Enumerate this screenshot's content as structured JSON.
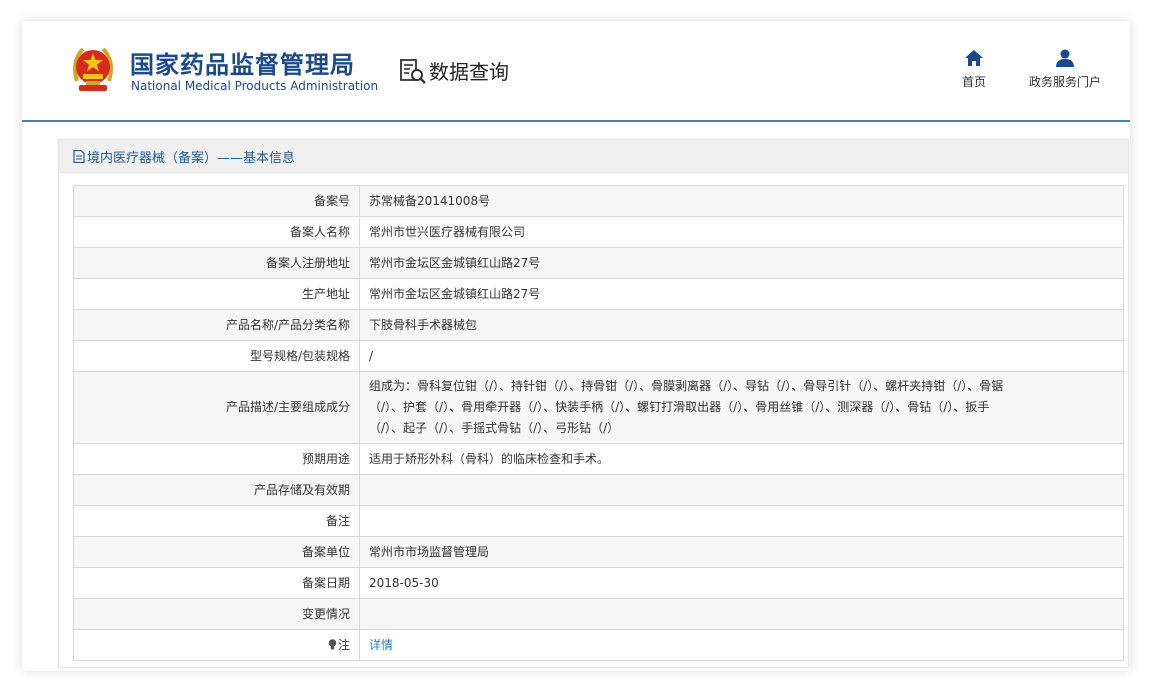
{
  "header": {
    "title_cn": "国家药品监督管理局",
    "title_en": "National Medical Products Administration",
    "query_label": "数据查询",
    "query_icon": "search-document-icon",
    "nav": [
      {
        "label": "首页",
        "icon": "home-icon"
      },
      {
        "label": "政务服务门户",
        "icon": "user-icon"
      }
    ]
  },
  "panel": {
    "title": "境内医疗器械（备案）——基本信息",
    "title_icon": "document-icon"
  },
  "rows": [
    {
      "key": "备案号",
      "value": "苏常械备20141008号"
    },
    {
      "key": "备案人名称",
      "value": "常州市世兴医疗器械有限公司"
    },
    {
      "key": "备案人注册地址",
      "value": "常州市金坛区金城镇红山路27号"
    },
    {
      "key": "生产地址",
      "value": "常州市金坛区金城镇红山路27号"
    },
    {
      "key": "产品名称/产品分类名称",
      "value": "下肢骨科手术器械包"
    },
    {
      "key": "型号规格/包装规格",
      "value": "/"
    },
    {
      "key": "产品描述/主要组成成分",
      "value_lines": [
        "组成为：骨科复位钳（/）、持针钳（/）、持骨钳（/）、骨膜剥离器（/）、导钻（/）、骨导引针（/）、螺杆夹持钳（/）、骨锯",
        "（/）、护套（/）、骨用牵开器（/）、快装手柄（/）、螺钉打滑取出器（/）、骨用丝锥（/）、测深器（/）、骨钻（/）、扳手",
        "（/）、起子（/）、手摇式骨钻（/）、弓形钻（/）"
      ]
    },
    {
      "key": "预期用途",
      "value": "适用于矫形外科（骨科）的临床检查和手术。"
    },
    {
      "key": "产品存储及有效期",
      "value": ""
    },
    {
      "key": "备注",
      "value": ""
    },
    {
      "key": "备案单位",
      "value": "常州市市场监督管理局"
    },
    {
      "key": "备案日期",
      "value": "2018-05-30"
    },
    {
      "key": "变更情况",
      "value": ""
    },
    {
      "key": "注",
      "icon": "lightbulb-icon",
      "link_label": "详情"
    }
  ],
  "colors": {
    "brand": "#1a4a8a",
    "link": "#2a7fc4",
    "divider": "#4a7ea8"
  }
}
